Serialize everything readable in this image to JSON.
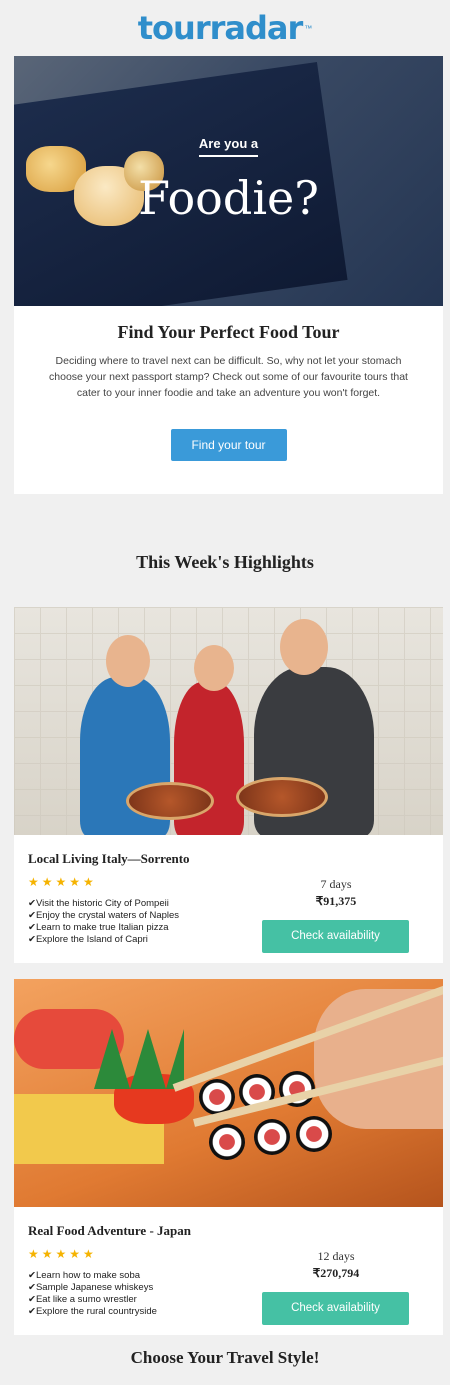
{
  "logo": {
    "text": "tourradar",
    "tm": "™"
  },
  "hero": {
    "pre_title": "Are you a",
    "title": "Foodie?"
  },
  "intro": {
    "heading": "Find Your Perfect Food Tour",
    "body": "Deciding where to travel next can be difficult. So, why not let your stomach choose your next passport stamp? Check out some of our favourite tours that cater to your inner foodie and take an adventure you won't forget.",
    "button": "Find your tour"
  },
  "highlights_title": "This Week's Highlights",
  "tours": [
    {
      "title": "Local Living Italy—Sorrento",
      "rating": 5,
      "features": [
        "Visit the historic City of Pompeii",
        "Enjoy the crystal waters of Naples",
        "Learn to make true Italian pizza",
        "Explore the Island of Capri"
      ],
      "duration": "7 days",
      "price": "₹91,375",
      "button": "Check availability"
    },
    {
      "title": "Real Food Adventure - Japan",
      "rating": 5,
      "features": [
        "Learn how to make soba",
        "Sample Japanese whiskeys",
        "Eat like a sumo wrestler",
        "Explore the rural countryside"
      ],
      "duration": "12 days",
      "price": "₹270,794",
      "button": "Check availability"
    }
  ],
  "footer_title": "Choose Your Travel Style!",
  "colors": {
    "brand": "#2f8ecb",
    "primary_button": "#3a9ad9",
    "availability_button": "#45c1a4",
    "stars": "#f5b301"
  }
}
